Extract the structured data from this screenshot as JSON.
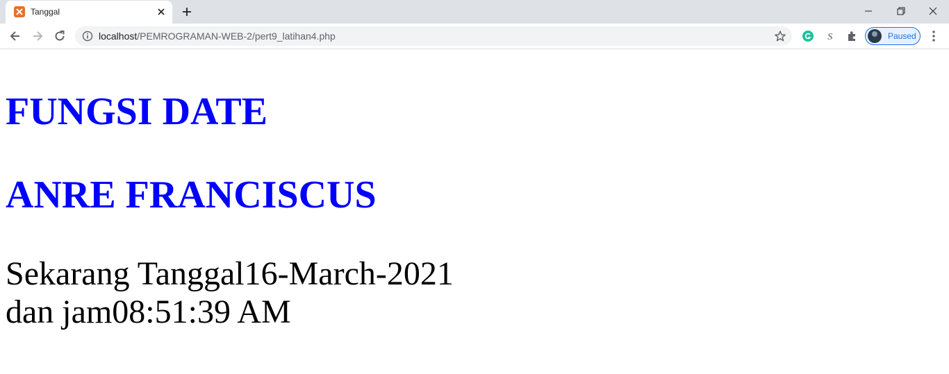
{
  "browser": {
    "tab": {
      "title": "Tanggal",
      "favicon": "xampp-icon"
    },
    "url": {
      "host": "localhost",
      "path": "/PEMROGRAMAN-WEB-2/pert9_latihan4.php"
    },
    "profile": {
      "label": "Paused"
    },
    "extensions": [
      "grammarly-icon",
      "s-extension-icon",
      "puzzle-icon"
    ]
  },
  "page": {
    "heading1": "FUNGSI DATE",
    "heading2": "ANRE FRANCISCUS",
    "date_line": "Sekarang Tanggal16-March-2021",
    "time_line": "dan jam08:51:39 AM"
  },
  "colors": {
    "heading": "#0000ff",
    "accent": "#1a73e8"
  }
}
